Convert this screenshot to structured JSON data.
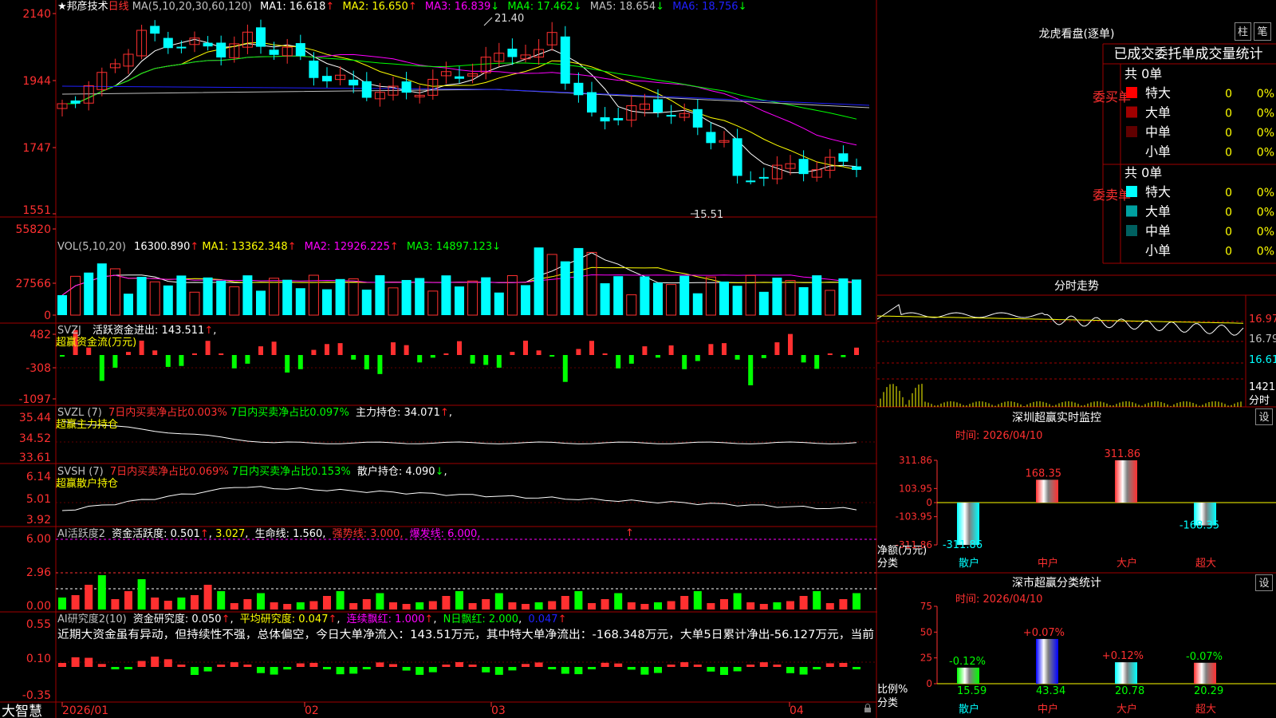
{
  "stock": {
    "star": "★",
    "name": "邦彦技术",
    "period": "日线"
  },
  "main_legend": {
    "ma_def": "MA(5,10,20,30,60,120)",
    "items": [
      {
        "text": "MA1: 16.618",
        "arrow": "↑",
        "color": "#ffffff",
        "arrow_color": "#ff2020"
      },
      {
        "text": "MA2: 16.650",
        "arrow": "↑",
        "color": "#ffff00",
        "arrow_color": "#ff2020"
      },
      {
        "text": "MA3: 16.839",
        "arrow": "↓",
        "color": "#ff00ff",
        "arrow_color": "#00ff00"
      },
      {
        "text": "MA4: 17.462",
        "arrow": "↓",
        "color": "#00ff00",
        "arrow_color": "#00ff00"
      },
      {
        "text": "MA5: 18.654",
        "arrow": "↓",
        "color": "#c0c0c0",
        "arrow_color": "#00ff00"
      },
      {
        "text": "MA6: 18.756",
        "arrow": "↓",
        "color": "#0000ff",
        "arrow_color": "#00ff00"
      }
    ],
    "high_marker": "21.40",
    "low_marker": "15.51"
  },
  "main_axis": [
    "2140",
    "1944",
    "1747",
    "1551"
  ],
  "vol_legend": {
    "def": "VOL(5,10,20)",
    "items": [
      {
        "text": "16300.890",
        "arrow": "↑",
        "color": "#ffffff",
        "arrow_color": "#ff2020"
      },
      {
        "text": "MA1: 13362.348",
        "arrow": "↑",
        "color": "#ffff00",
        "arrow_color": "#ff2020"
      },
      {
        "text": "MA2: 12926.225",
        "arrow": "↑",
        "color": "#ff00ff",
        "arrow_color": "#ff2020"
      },
      {
        "text": "MA3: 14897.123",
        "arrow": "↓",
        "color": "#00ff00",
        "arrow_color": "#00ff00"
      }
    ]
  },
  "vol_axis": [
    "55820",
    "27566",
    "0"
  ],
  "svzj": {
    "def": "SVZJ",
    "label": "活跃资金进出: 143.511",
    "arrow": "↑",
    "caption": "超赢资金流(万元)",
    "axis": [
      "482",
      "-308",
      "-1097"
    ]
  },
  "svzl": {
    "def": "SVZL (7)",
    "a": "7日内买卖净占比0.003%",
    "b": "7日内买卖净占比0.097%",
    "c": "主力持仓: 34.071",
    "arrow": "↑",
    "caption": "超赢主力持仓",
    "axis": [
      "35.44",
      "34.52",
      "33.61"
    ]
  },
  "svsh": {
    "def": "SVSH (7)",
    "a": "7日内买卖净占比0.069%",
    "b": "7日内买卖净占比0.153%",
    "c": "散户持仓: 4.090",
    "arrow": "↓",
    "caption": "超赢散户持仓",
    "axis": [
      "6.14",
      "5.01",
      "3.92"
    ]
  },
  "ai_active": {
    "def": "AI活跃度2",
    "a": "资金活跃度: 0.501",
    "b": "3.027",
    "c": "生命线: 1.560",
    "d": "强势线: 3.000",
    "e": "爆发线: 6.000",
    "axis": [
      "6.00",
      "2.96",
      "0.00"
    ]
  },
  "ai_research": {
    "def": "AI研究度2(10)",
    "a": "资金研究度: 0.050",
    "b": "平均研究度: 0.047",
    "c": "连续飘红: 1.000",
    "d": "N日飘红: 2.000",
    "e": "0.047",
    "axis": [
      "0.55",
      "0.10",
      "-0.35"
    ],
    "comment": "近期大资金虽有异动，但持续性不强，总体偏空，今日大单净流入：143.51万元，其中特大单净流出：-168.348万元，大单5日累计净出-56.127万元，当前"
  },
  "date_axis": [
    "2026/01",
    "02",
    "03",
    "04"
  ],
  "brand": "大智慧",
  "dragon": {
    "title": "龙虎看盘(逐单)",
    "btn1": "柱",
    "btn2": "笔",
    "subtitle": "已成交委托单成交量统计",
    "buy": {
      "side": "委买单",
      "total": "共 0单",
      "rows": [
        {
          "label": "特大",
          "count": "0",
          "pct": "0%",
          "color": "#ff0000"
        },
        {
          "label": "大单",
          "count": "0",
          "pct": "0%",
          "color": "#a00000"
        },
        {
          "label": "中单",
          "count": "0",
          "pct": "0%",
          "color": "#600000"
        },
        {
          "label": "小单",
          "count": "0",
          "pct": "0%",
          "color": ""
        }
      ]
    },
    "sell": {
      "side": "委卖单",
      "total": "共 0单",
      "rows": [
        {
          "label": "特大",
          "count": "0",
          "pct": "0%",
          "color": "#00ffff"
        },
        {
          "label": "大单",
          "count": "0",
          "pct": "0%",
          "color": "#00a0a0"
        },
        {
          "label": "中单",
          "count": "0",
          "pct": "0%",
          "color": "#006060"
        },
        {
          "label": "小单",
          "count": "0",
          "pct": "0%",
          "color": ""
        }
      ]
    }
  },
  "intraday": {
    "title": "分时走势",
    "axis": [
      "16.97",
      "16.79",
      "16.61"
    ],
    "vol_label": "1421",
    "vol_unit": "分时"
  },
  "monitor": {
    "title": "深圳超赢实时监控",
    "btn": "设",
    "time": "时间: 2026/04/10",
    "axis": [
      "311.86",
      "103.95",
      "0",
      "-103.95",
      "-311.86"
    ],
    "ylabel": "净额(万元)",
    "xlabel": "分类",
    "categories": [
      "散户",
      "中户",
      "大户",
      "超大"
    ],
    "value_labels": [
      "-311.86",
      "168.35",
      "311.86",
      "-168.35"
    ]
  },
  "classify": {
    "title": "深市超赢分类统计",
    "btn": "设",
    "time": "时间: 2026/04/10",
    "axis": [
      "75",
      "50",
      "25",
      "0"
    ],
    "ylabel": "比例%",
    "xlabel": "分类",
    "categories": [
      "散户",
      "中户",
      "大户",
      "超大"
    ],
    "change_labels": [
      "-0.12%",
      "+0.07%",
      "+0.12%",
      "-0.07%"
    ],
    "value_labels": [
      "15.59",
      "43.34",
      "20.78",
      "20.29"
    ]
  },
  "chart_data": [
    {
      "type": "bar",
      "title": "深圳超赢实时监控",
      "categories": [
        "散户",
        "中户",
        "大户",
        "超大"
      ],
      "values": [
        -311.86,
        168.35,
        311.86,
        -168.35
      ],
      "ylabel": "净额(万元)",
      "xlabel": "分类",
      "ylim": [
        -311.86,
        311.86
      ]
    },
    {
      "type": "bar",
      "title": "深市超赢分类统计",
      "categories": [
        "散户",
        "中户",
        "大户",
        "超大"
      ],
      "values": [
        15.59,
        43.34,
        20.78,
        20.29
      ],
      "ylabel": "比例%",
      "xlabel": "分类",
      "ylim": [
        0,
        75
      ]
    }
  ]
}
